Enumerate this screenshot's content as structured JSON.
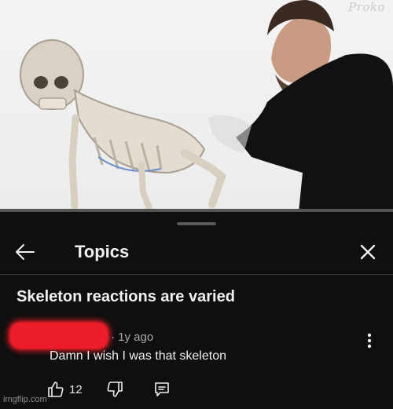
{
  "video": {
    "watermark": "Proko"
  },
  "panel": {
    "title": "Topics"
  },
  "topic": {
    "heading": "Skeleton reactions are varied"
  },
  "comment": {
    "time": "1y ago",
    "text": "Damn I wish I was that skeleton",
    "likes": "12",
    "redaction_color": "#ee1d2a"
  },
  "icons": [
    "back-arrow-icon",
    "close-icon",
    "more-vert-icon",
    "thumb-up-icon",
    "thumb-down-icon",
    "reply-icon"
  ],
  "site_watermark": "imgflip.com"
}
